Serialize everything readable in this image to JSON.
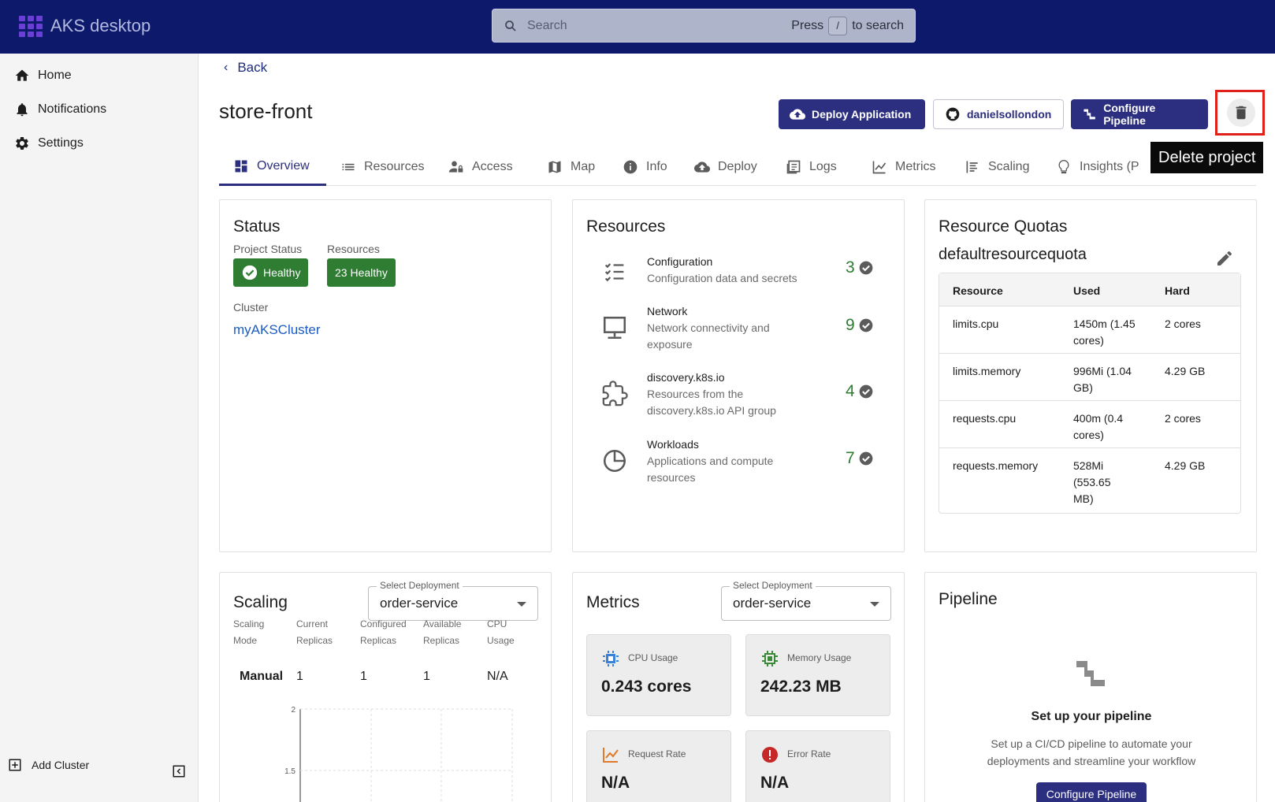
{
  "app": {
    "title": "AKS desktop"
  },
  "search": {
    "placeholder": "Search",
    "hint_press": "Press",
    "hint_key": "/",
    "hint_suffix": "to search"
  },
  "sidebar": {
    "items": [
      {
        "label": "Home",
        "icon": "home-icon"
      },
      {
        "label": "Notifications",
        "icon": "bell-icon"
      },
      {
        "label": "Settings",
        "icon": "gear-icon"
      }
    ],
    "add_cluster": "Add Cluster"
  },
  "header": {
    "back": "Back",
    "title": "store-front",
    "buttons": {
      "deploy": "Deploy Application",
      "github": "danielsollondon",
      "pipeline": "Configure Pipeline"
    },
    "tooltip": "Delete project"
  },
  "tabs": [
    {
      "label": "Overview",
      "icon": "dashboard-icon"
    },
    {
      "label": "Resources",
      "icon": "list-icon"
    },
    {
      "label": "Access",
      "icon": "user-lock-icon"
    },
    {
      "label": "Map",
      "icon": "map-icon"
    },
    {
      "label": "Info",
      "icon": "info-icon"
    },
    {
      "label": "Deploy",
      "icon": "cloud-upload-icon"
    },
    {
      "label": "Logs",
      "icon": "logs-icon"
    },
    {
      "label": "Metrics",
      "icon": "chart-line-icon"
    },
    {
      "label": "Scaling",
      "icon": "scaling-icon"
    },
    {
      "label": "Insights (P",
      "icon": "lightbulb-icon"
    }
  ],
  "status": {
    "title": "Status",
    "project_status_label": "Project Status",
    "project_status": "Healthy",
    "resources_label": "Resources",
    "resources_status": "23 Healthy",
    "cluster_label": "Cluster",
    "cluster": "myAKSCluster"
  },
  "resources": {
    "title": "Resources",
    "items": [
      {
        "name": "Configuration",
        "desc": "Configuration data and secrets",
        "count": "3"
      },
      {
        "name": "Network",
        "desc": "Network connectivity and exposure",
        "count": "9"
      },
      {
        "name": "discovery.k8s.io",
        "desc": "Resources from the discovery.k8s.io API group",
        "count": "4"
      },
      {
        "name": "Workloads",
        "desc": "Applications and compute resources",
        "count": "7"
      }
    ]
  },
  "quotas": {
    "title": "Resource Quotas",
    "name": "defaultresourcequota",
    "headers": [
      "Resource",
      "Used",
      "Hard"
    ],
    "rows": [
      [
        "limits.cpu",
        "1450m (1.45 cores)",
        "2 cores"
      ],
      [
        "limits.memory",
        "996Mi (1.04 GB)",
        "4.29 GB"
      ],
      [
        "requests.cpu",
        "400m (0.4 cores)",
        "2 cores"
      ],
      [
        "requests.memory",
        "528Mi (553.65 MB)",
        "4.29 GB"
      ]
    ]
  },
  "scaling": {
    "title": "Scaling",
    "select_label": "Select Deployment",
    "select_value": "order-service",
    "columns": [
      "Scaling Mode",
      "Current Replicas",
      "Configured Replicas",
      "Available Replicas",
      "CPU Usage"
    ],
    "values": [
      "Manual",
      "1",
      "1",
      "1",
      "N/A"
    ],
    "chart_ticks": [
      "2",
      "1.5"
    ]
  },
  "metrics": {
    "title": "Metrics",
    "select_label": "Select Deployment",
    "select_value": "order-service",
    "boxes": [
      {
        "label": "CPU Usage",
        "value": "0.243 cores"
      },
      {
        "label": "Memory Usage",
        "value": "242.23 MB"
      },
      {
        "label": "Request Rate",
        "value": "N/A"
      },
      {
        "label": "Error Rate",
        "value": "N/A"
      }
    ]
  },
  "pipeline": {
    "title": "Pipeline",
    "heading": "Set up your pipeline",
    "desc": "Set up a CI/CD pipeline to automate your deployments and streamline your workflow",
    "button": "Configure Pipeline"
  },
  "colors": {
    "topbar": "#0d1a6b",
    "primary": "#2c2f80",
    "success": "#2e7d32",
    "link": "#1d5bbf",
    "highlight": "#e0211b"
  }
}
